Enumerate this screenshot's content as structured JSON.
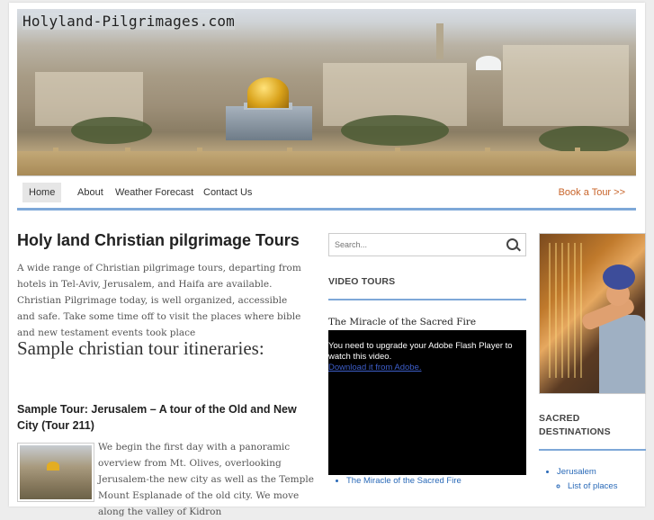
{
  "header": {
    "site_title": "Holyland-Pilgrimages.com"
  },
  "nav": {
    "items": [
      {
        "label": "Home"
      },
      {
        "label": "About"
      },
      {
        "label": "Weather Forecast"
      },
      {
        "label": "Contact Us"
      }
    ],
    "cta": "Book a Tour >>"
  },
  "main": {
    "title": "Holy land Christian pilgrimage Tours",
    "intro": "A wide range of Christian pilgrimage tours, departing from hotels in Tel-Aviv, Jerusalem, and Haifa are available.  Christian Pilgrimage today, is well organized, accessible and safe. Take some time off to visit the places where bible and new testament events took place",
    "section_title": "Sample christian tour itineraries:",
    "tour_title": "Sample Tour: Jerusalem – A tour of the Old and New City (Tour 211)",
    "tour_text": "We begin the first day with a panoramic overview from Mt. Olives, overlooking Jerusalem-the new city as well as the Temple Mount Esplanade of the old city. We move along the valley of Kidron"
  },
  "middle": {
    "search_placeholder": "Search...",
    "widget_title": "VIDEO TOURS",
    "video_title": "The Miracle of the Sacred Fire",
    "flash_message": "You need to upgrade your Adobe Flash Player to watch this video.",
    "flash_link": "Download it from Adobe.",
    "list": [
      "The Miracle of the Sacred Fire"
    ]
  },
  "sidebar": {
    "widget_title": "SACRED DESTINATIONS",
    "items": [
      {
        "label": "Jerusalem",
        "children": [
          "List of places"
        ]
      }
    ]
  },
  "colors": {
    "accent_rule": "#7ea8d8",
    "cta": "#c8642a",
    "link": "#2a6ab8"
  }
}
